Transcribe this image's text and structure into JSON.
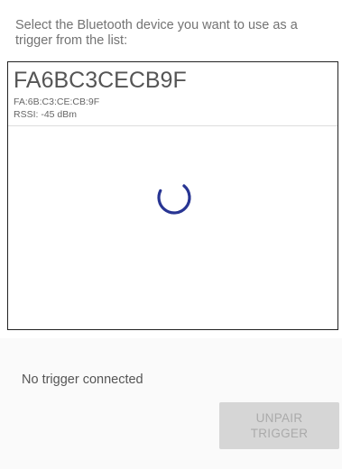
{
  "instruction": "Select the Bluetooth device you want to use as a trigger from the list:",
  "devices": [
    {
      "name": "FA6BC3CECB9F",
      "address": "FA:6B:C3:CE:CB:9F",
      "rssi": "RSSI: -45 dBm"
    }
  ],
  "status": "No trigger connected",
  "unpair_button": {
    "label": "UNPAIR\nTRIGGER",
    "enabled": false
  },
  "colors": {
    "spinner": "#283593",
    "button_disabled_bg": "#d6d6d6",
    "button_disabled_text": "#aaaaaa"
  },
  "icons": {
    "loading": "progress-spinner-icon"
  }
}
